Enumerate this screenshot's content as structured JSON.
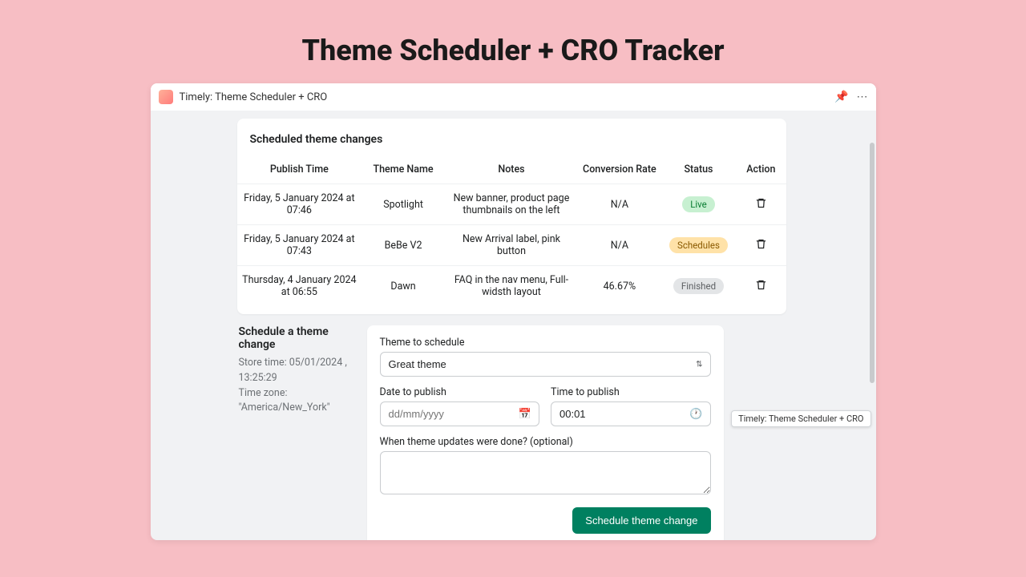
{
  "page_heading": "Theme Scheduler + CRO Tracker",
  "window": {
    "title": "Timely: Theme Scheduler + CRO"
  },
  "tooltip": "Timely: Theme Scheduler + CRO",
  "scheduled_card": {
    "title": "Scheduled theme changes",
    "columns": {
      "publish": "Publish Time",
      "theme": "Theme Name",
      "notes": "Notes",
      "rate": "Conversion Rate",
      "status": "Status",
      "action": "Action"
    },
    "rows": [
      {
        "publish": "Friday, 5 January 2024 at 07:46",
        "theme": "Spotlight",
        "notes": "New banner, product page thumbnails on the left",
        "rate": "N/A",
        "status": "Live",
        "status_class": "live"
      },
      {
        "publish": "Friday, 5 January 2024 at 07:43",
        "theme": "BeBe V2",
        "notes": "New Arrival label, pink button",
        "rate": "N/A",
        "status": "Schedules",
        "status_class": "schedules"
      },
      {
        "publish": "Thursday, 4 January 2024 at 06:55",
        "theme": "Dawn",
        "notes": "FAQ in the nav menu, Full-widsth layout",
        "rate": "46.67%",
        "status": "Finished",
        "status_class": "finished"
      }
    ]
  },
  "schedule_form": {
    "heading": "Schedule a theme change",
    "store_time": "Store time: 05/01/2024 , 13:25:29",
    "time_zone": "Time zone: \"America/New_York\"",
    "theme_label": "Theme to schedule",
    "theme_value": "Great theme",
    "date_label": "Date to publish",
    "date_placeholder": "dd/mm/yyyy",
    "time_label": "Time to publish",
    "time_value": "00:01",
    "notes_label": "When theme updates were done? (optional)",
    "submit_label": "Schedule theme change"
  }
}
